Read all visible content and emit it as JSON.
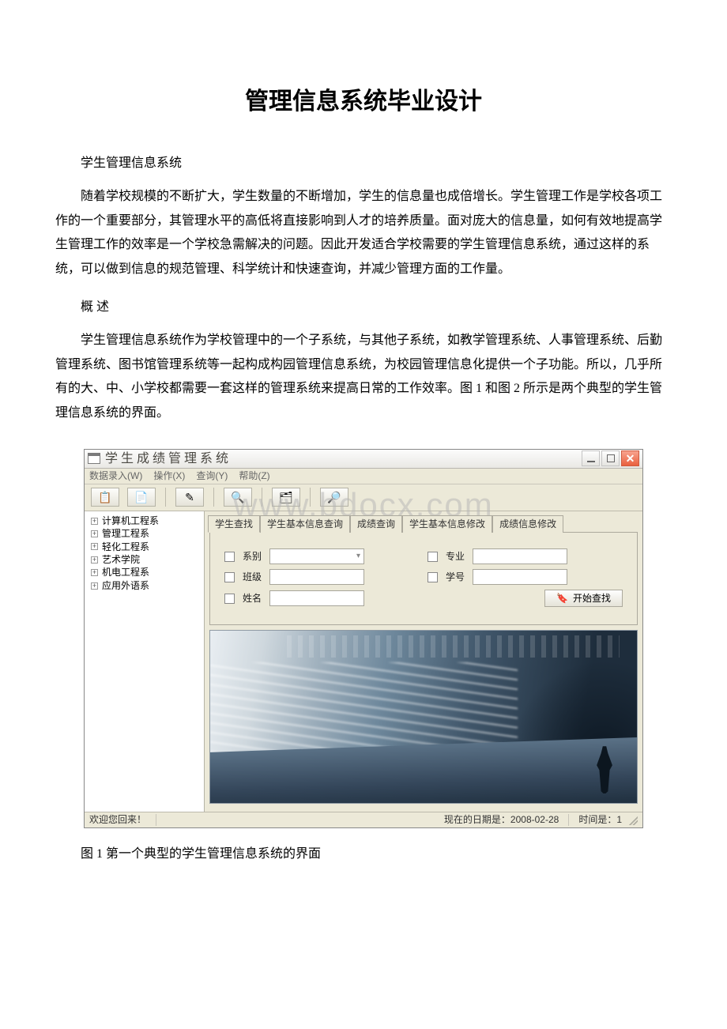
{
  "doc": {
    "title": "管理信息系统毕业设计",
    "sub1": "学生管理信息系统",
    "p1": "随着学校规模的不断扩大，学生数量的不断增加，学生的信息量也成倍增长。学生管理工作是学校各项工作的一个重要部分，其管理水平的高低将直接影响到人才的培养质量。面对庞大的信息量，如何有效地提高学生管理工作的效率是一个学校急需解决的问题。因此开发适合学校需要的学生管理信息系统，通过这样的系统，可以做到信息的规范管理、科学统计和快速查询，并减少管理方面的工作量。",
    "sub2": "概 述",
    "p2": "学生管理信息系统作为学校管理中的一个子系统，与其他子系统，如教学管理系统、人事管理系统、后勤管理系统、图书馆管理系统等一起构成构园管理信息系统，为校园管理信息化提供一个子功能。所以，几乎所有的大、中、小学校都需要一套这样的管理系统来提高日常的工作效率。图 1 和图 2 所示是两个典型的学生管理信息系统的界面。",
    "caption": "图 1 第一个典型的学生管理信息系统的界面"
  },
  "app": {
    "watermark": "www.bdocx.com",
    "title": "学生成绩管理系统",
    "closeGlyph": "✕",
    "menu": {
      "m1": "数据录入(W)",
      "m2": "操作(X)",
      "m3": "查询(Y)",
      "m4": "帮助(Z)"
    },
    "toolbar": {
      "i1": "📋",
      "i2": "📄",
      "i3": "✎",
      "i4": "🔍",
      "i5": "🗂",
      "i6": "🔎"
    },
    "tree": [
      {
        "label": "计算机工程系"
      },
      {
        "label": "管理工程系"
      },
      {
        "label": "轻化工程系"
      },
      {
        "label": "艺术学院"
      },
      {
        "label": "机电工程系"
      },
      {
        "label": "应用外语系"
      }
    ],
    "tabs": {
      "t0": "学生查找",
      "t1": "学生基本信息查询",
      "t2": "成绩查询",
      "t3": "学生基本信息修改",
      "t4": "成绩信息修改"
    },
    "form": {
      "dept": "系别",
      "major": "专业",
      "classLbl": "班级",
      "sid": "学号",
      "nameLbl": "姓名",
      "searchBtn": "开始查找"
    },
    "status": {
      "welcome": "欢迎您回来！",
      "date": "现在的日期是：2008-02-28",
      "time": "时间是：1"
    }
  }
}
